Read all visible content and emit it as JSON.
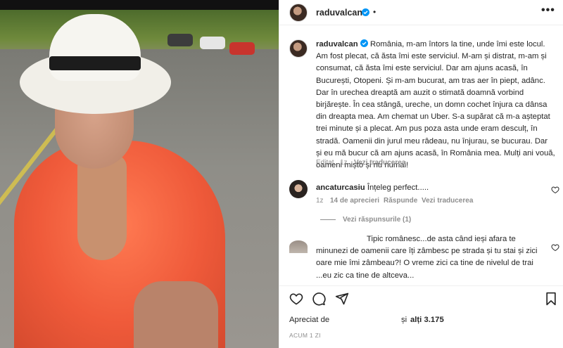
{
  "post": {
    "author": "raduvalcan",
    "header_dot": "•",
    "more_label": "•••",
    "caption": "România, m-am întors la tine, unde îmi este locul. Am fost plecat, că ăsta îmi este serviciul. M-am și distrat, m-am și consumat, că ăsta îmi este serviciul. Dar am ajuns acasă, în București, Otopeni. Și m-am bucurat, am tras aer în piept, adânc. Dar în urechea dreaptă am auzit o stimată doamnă vorbind birjărește. În cea stângă, ureche, un domn cochet înjura ca dânsa din dreapta mea. Am chemat un Uber. S-a supărat că m-a așteptat trei minute și a plecat. Am pus poza asta unde eram desculț, în stradă. Oamenii din jurul meu râdeau, nu înjurau, se bucurau. Dar și eu mă bucur că am ajuns acasă, în România mea. Mulți ani vouă, oameni mișto și nu numai!",
    "caption_meta": {
      "edited": "Editat",
      "time": "1z",
      "translate": "Vezi traducerea"
    }
  },
  "comments": [
    {
      "author": "ancaturcasiu",
      "text": "Înțeleg perfect.....",
      "time": "1z",
      "date": "14 de aprecieri",
      "reply": "Răspunde",
      "translate": "Vezi traducerea",
      "view_replies": "Vezi răspunsurile (1)"
    },
    {
      "author": "",
      "text_lines": [
        "Tipic românesc...de asta când ieși afara te",
        "minunezi de oamenii care îți zâmbesc pe strada și tu stai și zici",
        "oare mie îmi zâmbeau?! O vreme zici ca tine de nivelul de trai",
        "...eu zic ca tine de altceva..."
      ]
    }
  ],
  "footer": {
    "liked_by_prefix": "Apreciat de",
    "liked_by_suffix": "și",
    "others": "alți 3.175",
    "time_ago": "ACUM 1 ZI"
  },
  "icons": {
    "like": "heart-icon",
    "comment": "comment-icon",
    "share": "send-icon",
    "save": "bookmark-icon",
    "verified": "verified-badge-icon",
    "more": "more-options-icon"
  },
  "colors": {
    "verified": "#0095f6",
    "text": "#262626",
    "muted": "#8e8e8e",
    "border": "#efefef"
  }
}
